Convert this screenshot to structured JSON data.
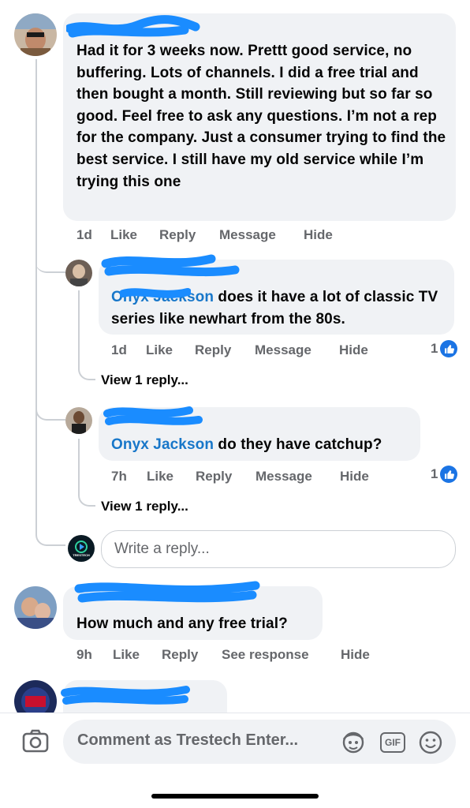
{
  "comments": [
    {
      "text": "Had it for 3 weeks now. Prettt good service, no buffering. Lots of channels. I did a free trial and then bought a month. Still reviewing but so far so good. Feel free to ask any questions. I’m not a rep for the company. Just a consumer trying to find the best service. I still have my old service while I’m trying this one",
      "actions": {
        "time": "1d",
        "like": "Like",
        "reply": "Reply",
        "message": "Message",
        "hide": "Hide"
      },
      "replies": [
        {
          "mention": "Onyx Jackson",
          "text": " does it have a lot of classic TV series like newhart from the 80s.",
          "actions": {
            "time": "1d",
            "like": "Like",
            "reply": "Reply",
            "message": "Message",
            "hide": "Hide"
          },
          "like_count": "1",
          "view_replies": "View 1 reply..."
        },
        {
          "mention": "Onyx Jackson",
          "text": " do they have catchup?",
          "actions": {
            "time": "7h",
            "like": "Like",
            "reply": "Reply",
            "message": "Message",
            "hide": "Hide"
          },
          "like_count": "1",
          "view_replies": "View 1 reply..."
        }
      ],
      "reply_box": {
        "placeholder": "Write a reply...",
        "avatar_label": "TRESTECH"
      }
    },
    {
      "text": "How much and any free trial?",
      "actions": {
        "time": "9h",
        "like": "Like",
        "reply": "Reply",
        "see_response": "See response",
        "hide": "Hide"
      }
    }
  ],
  "composer": {
    "placeholder": "Comment as Trestech Enter...",
    "gif_label": "GIF"
  },
  "colors": {
    "mention": "#1877c9",
    "bubble": "#f0f2f5",
    "muted": "#65676b",
    "scribble": "#1a8cff",
    "like": "#1b74e4"
  }
}
